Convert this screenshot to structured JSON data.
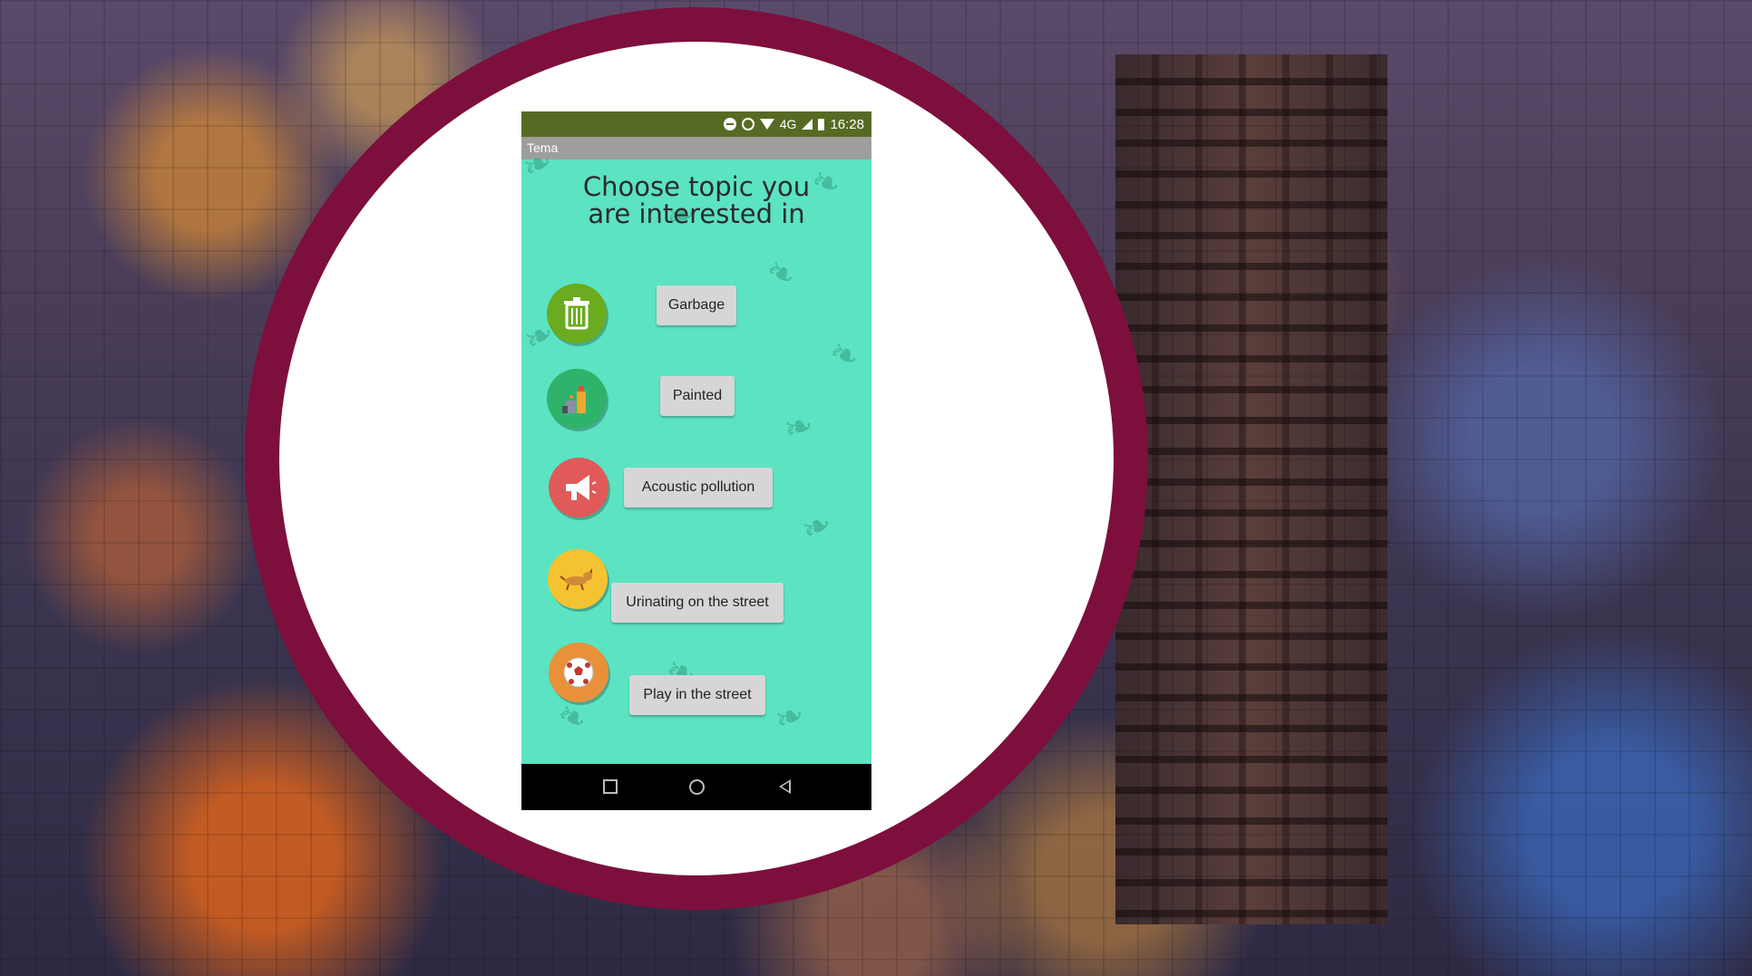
{
  "status_bar": {
    "time": "16:28",
    "network": "4G"
  },
  "app": {
    "title": "Tema"
  },
  "heading": {
    "line1": "Choose topic you",
    "line2": "are interested in"
  },
  "topics": [
    {
      "label": "Garbage",
      "icon": "trash-bin-icon",
      "color": "#6aab1f"
    },
    {
      "label": "Painted",
      "icon": "spray-paint-icon",
      "color": "#2fb36a"
    },
    {
      "label": "Acoustic pollution",
      "icon": "megaphone-icon",
      "color": "#e05a5a"
    },
    {
      "label": "Urinating on the street",
      "icon": "dog-icon",
      "color": "#f5c331"
    },
    {
      "label": "Play in the street",
      "icon": "soccer-ball-icon",
      "color": "#e8913a"
    }
  ],
  "nav": {
    "recent": "recent-apps-icon",
    "home": "home-icon",
    "back": "back-icon"
  },
  "colors": {
    "ring": "#7d0f3c",
    "screen_bg": "#5be3c2",
    "status_bar": "#556b23",
    "title_bar": "#9e9e9e"
  }
}
